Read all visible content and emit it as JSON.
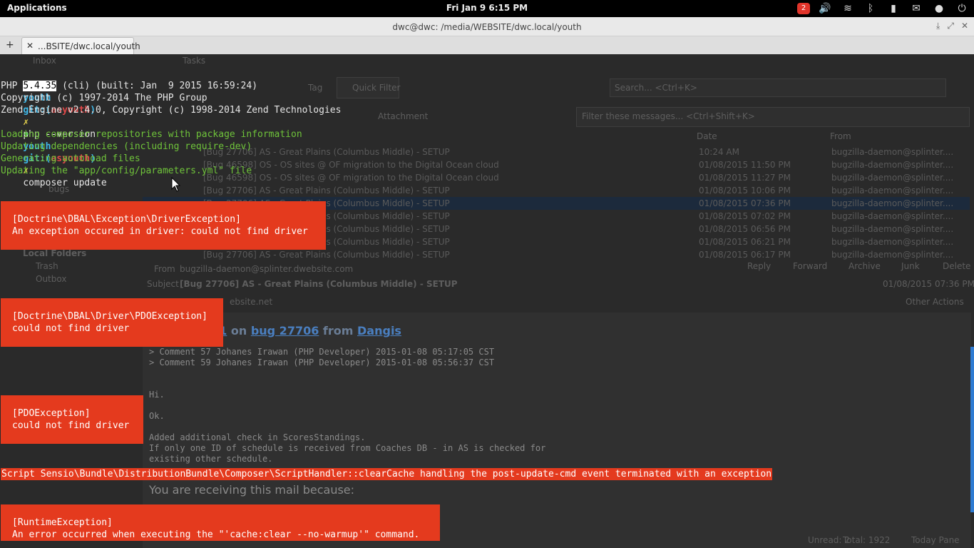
{
  "topbar": {
    "applications": "Applications",
    "clock": "Fri Jan  9  6:15 PM",
    "mail_count": "2"
  },
  "window": {
    "title": "dwc@dwc: /media/WEBSITE/dwc.local/youth",
    "tab_label": "...BSITE/dwc.local/youth",
    "new_tab": "+",
    "close_tab": "✕"
  },
  "terminal": {
    "lines": [
      {
        "arrow": "➜",
        "cwd": "youth",
        "git": "git:(",
        "branch": "asyouth",
        "gitclose": ")",
        "dirty": "✗",
        "cmd": "php --version"
      },
      {
        "text_before": "PHP ",
        "highlight": "5.4.35",
        "text_after": " (cli) (built: Jan  9 2015 16:59:24)"
      },
      {
        "text": "Copyright (c) 1997-2014 The PHP Group"
      },
      {
        "text": "Zend Engine v2.4.0, Copyright (c) 1998-2014 Zend Technologies"
      },
      {
        "arrow": "➜",
        "cwd": "youth",
        "git": "git:(",
        "branch": "asyouth",
        "gitclose": ")",
        "dirty": "✗",
        "cmd": "composer update"
      },
      {
        "text": "Loading composer repositories with package information",
        "color": "green"
      },
      {
        "text": "Updating dependencies (including require-dev)",
        "color": "green"
      },
      {
        "text": "Generating autoload files",
        "color": "green"
      },
      {
        "text": "Updating the \"app/config/parameters.yml\" file",
        "color": "green"
      }
    ],
    "errors": [
      {
        "title": "[Doctrine\\DBAL\\Exception\\DriverException]",
        "message": "An exception occured in driver: could not find driver"
      },
      {
        "title": "[Doctrine\\DBAL\\Driver\\PDOException]",
        "message": "could not find driver"
      },
      {
        "title": "[PDOException]",
        "message": "could not find driver"
      },
      {
        "title": "[RuntimeException]",
        "message": "An error occurred when executing the \"'cache:clear --no-warmup'\" command."
      }
    ],
    "script_error": "Script Sensio\\Bundle\\DistributionBundle\\Composer\\ScriptHandler::clearCache handling the post-update-cmd event terminated with an exception"
  },
  "mail": {
    "inbox_tab": "Inbox",
    "tasks_tab": "Tasks",
    "tag": "Tag",
    "quick_filter": "Quick Filter",
    "search_placeholder": "Search... <Ctrl+K>",
    "filter_placeholder": "Filter these messages... <Ctrl+Shift+K>",
    "attachment": "Attachment",
    "col_date": "Date",
    "col_from": "From",
    "sidebar": [
      "Local Folders",
      "Trash",
      "Outbox",
      "bugs"
    ],
    "rows": [
      {
        "subject": "[Bug 27706] AS - Great Plains (Columbus Middle) - SETUP",
        "date": "10:24 AM",
        "from": "bugzilla-daemon@splinter...."
      },
      {
        "subject": "[Bug 46598] OS - OS sites @ OF migration to the Digital Ocean cloud",
        "date": "01/08/2015 11:50 PM",
        "from": "bugzilla-daemon@splinter...."
      },
      {
        "subject": "[Bug 46598] OS - OS sites @ OF migration to the Digital Ocean cloud",
        "date": "01/08/2015 11:27 PM",
        "from": "bugzilla-daemon@splinter...."
      },
      {
        "subject": "[Bug 27706] AS - Great Plains (Columbus Middle) - SETUP",
        "date": "01/08/2015 10:06 PM",
        "from": "bugzilla-daemon@splinter...."
      },
      {
        "subject": "[Bug 27706] AS - Great Plains (Columbus Middle) - SETUP",
        "date": "01/08/2015 07:36 PM",
        "from": "bugzilla-daemon@splinter...."
      },
      {
        "subject": "[Bug 27706] AS - Great Plains (Columbus Middle) - SETUP",
        "date": "01/08/2015 07:02 PM",
        "from": "bugzilla-daemon@splinter...."
      },
      {
        "subject": "[Bug 27706] AS - Great Plains (Columbus Middle) - SETUP",
        "date": "01/08/2015 06:56 PM",
        "from": "bugzilla-daemon@splinter...."
      },
      {
        "subject": "[Bug 27706] AS - Great Plains (Columbus Middle) - SETUP",
        "date": "01/08/2015 06:21 PM",
        "from": "bugzilla-daemon@splinter...."
      },
      {
        "subject": "[Bug 27706] AS - Great Plains (Columbus Middle) - SETUP",
        "date": "01/08/2015 06:17 PM",
        "from": "bugzilla-daemon@splinter...."
      }
    ],
    "header_from_label": "From",
    "header_from": "bugzilla-daemon@splinter.dwebsite.com",
    "header_subject_label": "Subject",
    "header_subject": "[Bug 27706] AS - Great Plains (Columbus Middle) - SETUP",
    "header_date": "01/08/2015 07:36 PM",
    "to_partial": "ebsite.net",
    "other_actions": "Other Actions",
    "reply": "Reply",
    "forward": "Forward",
    "archive": "Archive",
    "junk": "Junk",
    "delete": "Delete",
    "body_heading": {
      "comment": "61",
      "on": "on",
      "bug": "bug 27706",
      "from": "from",
      "user": "Dangis"
    },
    "quote1": "> Comment 57  Johanes Irawan (PHP Developer)  2015-01-08 05:17:05 CST",
    "quote2": "> Comment 59  Johanes Irawan (PHP Developer)  2015-01-08 05:56:37 CST",
    "body": [
      "Hi.",
      "Ok.",
      "Added additional check in ScoresStandings.",
      "If only one ID of schedule is received from Coaches DB - in AS is checked for",
      "existing other schedule."
    ],
    "receiving": "You are receiving this mail because:",
    "unread": "Unread: 2",
    "total": "Total: 1922",
    "today_pane": "Today Pane"
  }
}
